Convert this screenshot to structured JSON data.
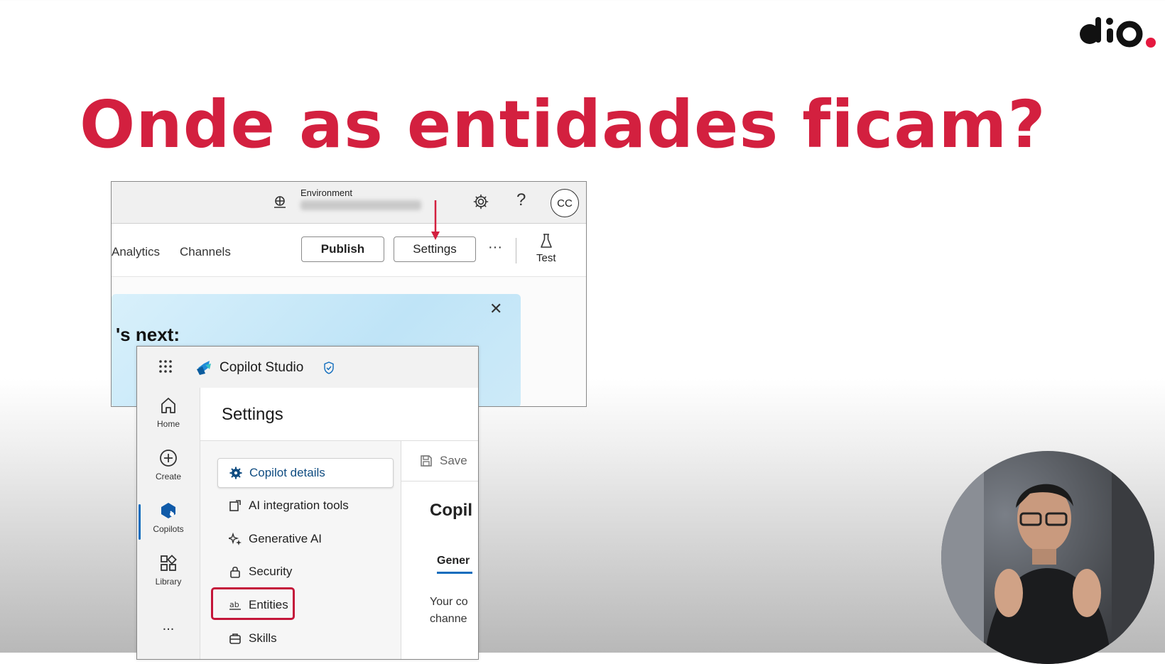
{
  "slide": {
    "title": "Onde as entidades ficam?",
    "title_color": "#d3203f",
    "brand": "dio.",
    "brand_accent": "#e5193f"
  },
  "studio_header": {
    "environment_label": "Environment",
    "environment_value_blurred": true,
    "gear_icon": "settings-gear-icon",
    "help_label": "?",
    "avatar_initials": "CC"
  },
  "command_bar": {
    "nav": [
      "Analytics",
      "Channels"
    ],
    "publish_label": "Publish",
    "settings_label": "Settings",
    "more_label": "···",
    "test_label": "Test",
    "arrow_color": "#d3203f"
  },
  "banner": {
    "title": "'s next:",
    "close_label": "✕"
  },
  "copilot_studio": {
    "app_name": "Copilot Studio",
    "rail": [
      {
        "label": "Home",
        "icon": "home-icon"
      },
      {
        "label": "Create",
        "icon": "plus-circle-icon"
      },
      {
        "label": "Copilots",
        "icon": "copilot-icon"
      },
      {
        "label": "Library",
        "icon": "library-icon"
      },
      {
        "label": "...",
        "icon": "more-icon"
      }
    ],
    "page_title": "Settings",
    "menu": [
      {
        "label": "Copilot details",
        "icon": "gear-icon",
        "active": true
      },
      {
        "label": "AI integration tools",
        "icon": "integration-icon"
      },
      {
        "label": "Generative AI",
        "icon": "sparkle-icon"
      },
      {
        "label": "Security",
        "icon": "lock-icon"
      },
      {
        "label": "Entities",
        "icon": "entities-icon",
        "highlighted": true
      },
      {
        "label": "Skills",
        "icon": "skills-icon"
      }
    ],
    "save_label": "Save",
    "content_title": "Copil",
    "tab_label": "Gener",
    "description_line1": "Your co",
    "description_line2": "channe"
  },
  "highlight_color": "#c4163a"
}
